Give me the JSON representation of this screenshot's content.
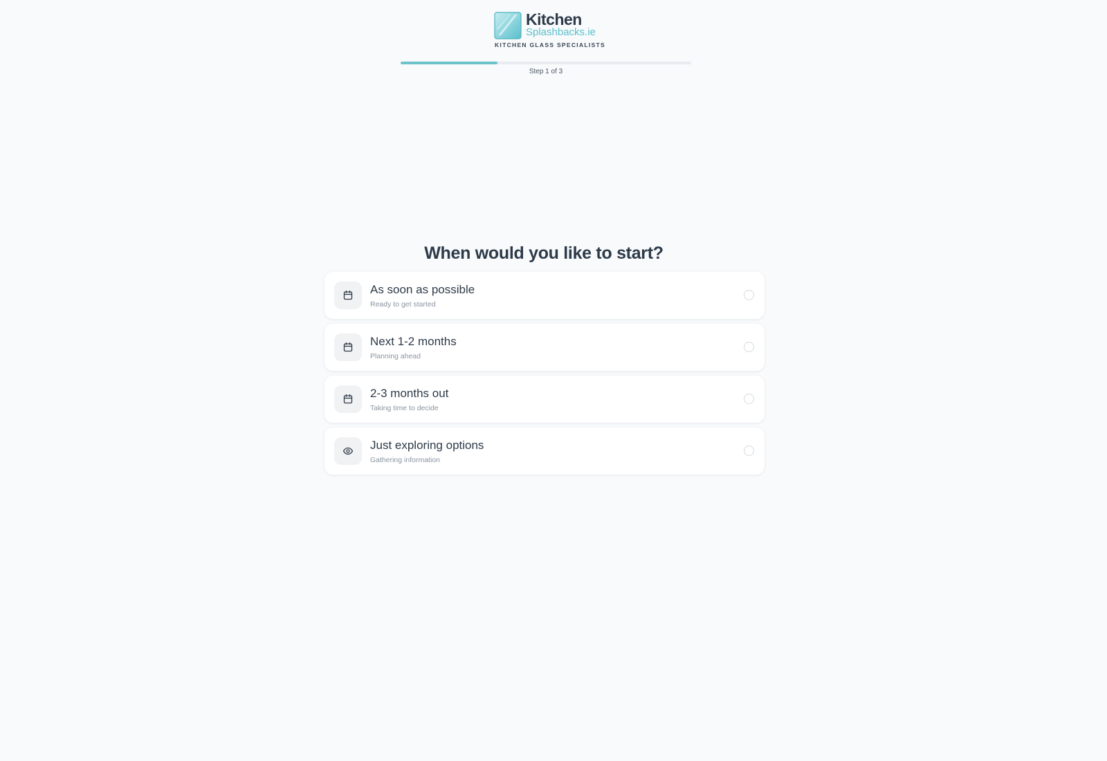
{
  "brand": {
    "name_line1": "Kitchen",
    "name_line2": "Splashbacks.ie",
    "tagline": "KITCHEN GLASS SPECIALISTS",
    "colors": {
      "accent": "#6cc3c9",
      "secondary": "#5bbfcb",
      "text": "#2d3a48"
    }
  },
  "progress": {
    "current_step": 1,
    "total_steps": 3,
    "fraction": 0.333,
    "label": "Step 1 of 3"
  },
  "question": {
    "title": "When would you like to start?"
  },
  "options": [
    {
      "icon": "calendar-icon",
      "title": "As soon as possible",
      "subtitle": "Ready to get started",
      "selected": false
    },
    {
      "icon": "calendar-icon",
      "title": "Next 1-2 months",
      "subtitle": "Planning ahead",
      "selected": false
    },
    {
      "icon": "calendar-icon",
      "title": "2-3 months out",
      "subtitle": "Taking time to decide",
      "selected": false
    },
    {
      "icon": "eye-icon",
      "title": "Just exploring options",
      "subtitle": "Gathering information",
      "selected": false
    }
  ]
}
